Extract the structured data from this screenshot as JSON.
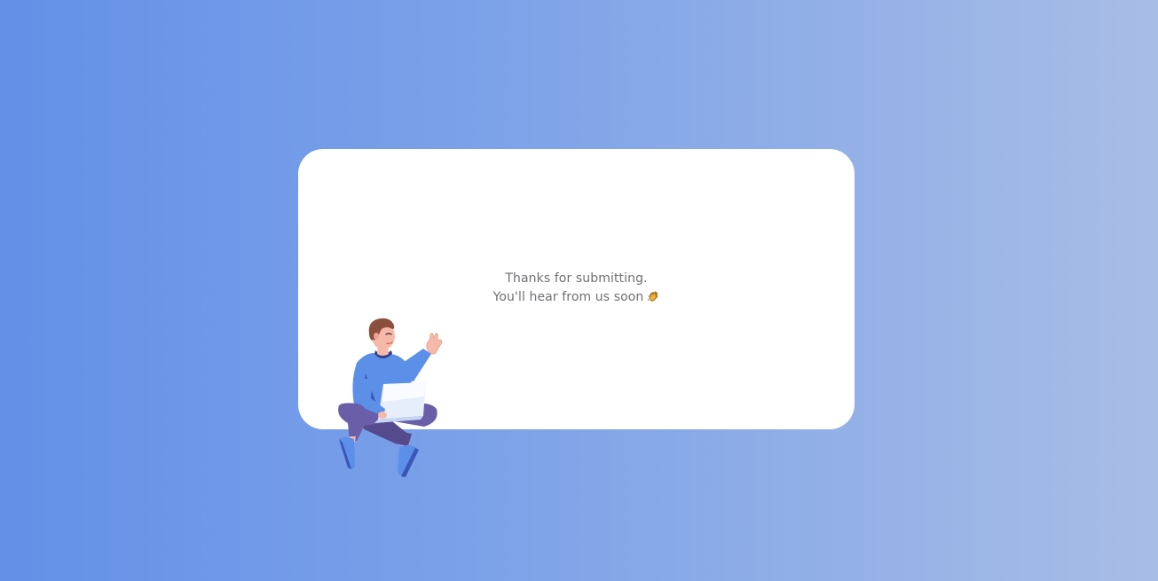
{
  "confirmation": {
    "line1": "Thanks for submitting.",
    "line2": "You'll hear from us soon",
    "icon": "clapping-hands-icon"
  },
  "illustration": {
    "icon": "person-with-laptop-waving"
  },
  "colors": {
    "background_start": "#6390e7",
    "background_end": "#a8bde6",
    "card": "#ffffff",
    "text": "#6f6f75"
  }
}
